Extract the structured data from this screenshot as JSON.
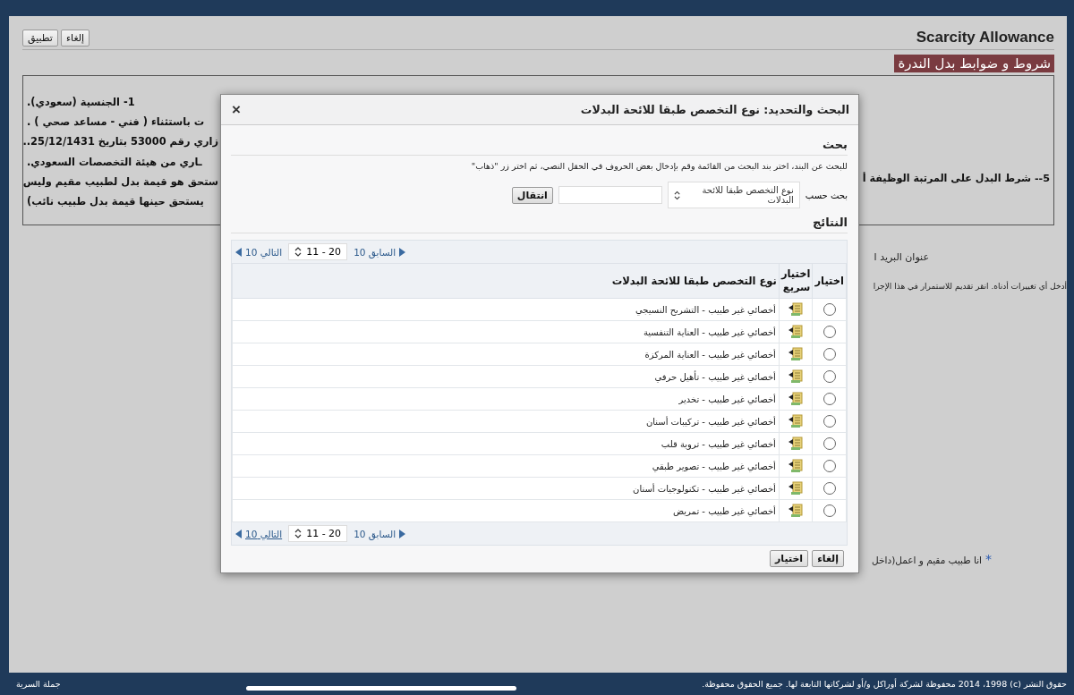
{
  "header": {
    "title": "Scarcity Allowance",
    "buttons": [
      {
        "label": "إلغاء"
      },
      {
        "label": "تطبيق"
      }
    ]
  },
  "section_title": "شروط و ضوابط بدل الندرة",
  "conditions": {
    "right_line": "5-- شرط البدل على المرتبة الوظيفة أ",
    "left_lines": [
      "1- الجنسية (سعودي).",
      "ت باستثناء ( فني - مساعد صحي ) .",
      "زاري رقم 53000 بتاريخ 25/12/1431..",
      "ـاري من هيئة التخصصات السعودي.",
      "ستحق هو قيمة بدل لطبيب مقيم وليس",
      "يستحق حينها قيمة بدل طبيب نائب)"
    ]
  },
  "email_label": "عنوان البريد ا",
  "instructions": "أدخل أي تغييرات أدناه. انقر تقديم للاستمرار في هذا الإجرا",
  "question": {
    "label": "انا طبيب مقيم و اعمل(داخل",
    "required_mark": "*"
  },
  "dialog": {
    "title": "البحث والتحديد: نوع التخصص طبقا للائحة البدلات",
    "close": "×",
    "search_heading": "بحث",
    "hint": "للبحث عن البند، اختر بند البحث من القائمة وقم بإدخال بعض الحروف في الحقل النصي، ثم اختر زر \"ذهاب\"",
    "search_by_label": "بحث حسب",
    "search_by_value": "نوع التخصص طبقا للائحة البدلات",
    "go_button": "انتقال",
    "results_heading": "النتائج",
    "pager_top": {
      "previous": "السابق 10",
      "range": "11 - 20",
      "next": "التالي 10",
      "next_focused": false
    },
    "columns": [
      "اختيار",
      "اختيار سريع",
      "نوع التخصص طبقا للائحة البدلات"
    ],
    "rows": [
      {
        "selected": false,
        "name": "أخصائي غير طبيب - التشريح النسيجي"
      },
      {
        "selected": false,
        "name": "أخصائي غير طبيب - العناية التنفسية"
      },
      {
        "selected": false,
        "name": "أخصائي غير طبيب - العناية المركزة"
      },
      {
        "selected": false,
        "name": "أخصائي غير طبيب - تأهيل حرفي"
      },
      {
        "selected": false,
        "name": "أخصائي غير طبيب - تخدير"
      },
      {
        "selected": false,
        "name": "أخصائي غير طبيب - تركيبات أسنان"
      },
      {
        "selected": false,
        "name": "أخصائي غير طبيب - تروية قلب"
      },
      {
        "selected": false,
        "name": "أخصائي غير طبيب - تصوير طبقي"
      },
      {
        "selected": false,
        "name": "أخصائي غير طبيب - تكنولوجيات أسنان"
      },
      {
        "selected": false,
        "name": "أخصائي غير طبيب - تمريض"
      }
    ],
    "pager_bottom": {
      "previous": "السابق 10",
      "range": "11 - 20",
      "next": "التالي 10",
      "next_focused": true
    },
    "buttons": [
      {
        "label": "إلغاء"
      },
      {
        "label": "اختيار"
      }
    ]
  },
  "footer": {
    "copyright": "حقوق النشر (c) 2014 ،1998 محفوظة لشركة أوراكل و/أو لشركاتها التابعة لها. جميع الحقوق محفوظة.",
    "privacy": "جملة السرية"
  }
}
